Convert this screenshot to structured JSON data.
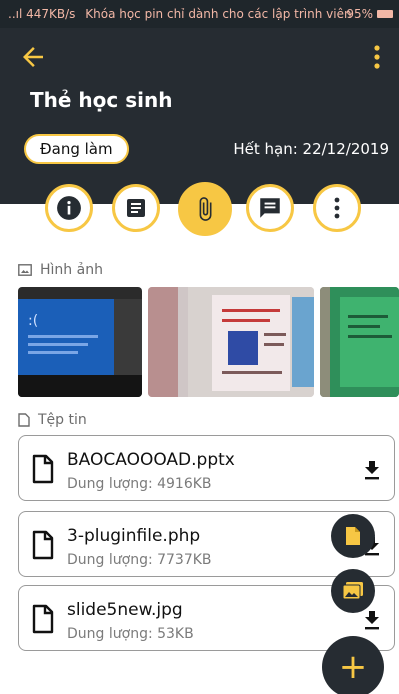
{
  "status_bar": {
    "left_text": "..ıl 447KB/s",
    "notification_text": "Khóa học pin chỉ dành cho các lập trình viên",
    "battery": "95%"
  },
  "header": {
    "title": "Thẻ học sinh",
    "status_label": "Đang làm",
    "expiry_label": "Hết hạn: 22/12/2019"
  },
  "tabs": [
    {
      "icon": "info-icon",
      "active": false
    },
    {
      "icon": "document-icon",
      "active": false
    },
    {
      "icon": "attachment-icon",
      "active": true
    },
    {
      "icon": "comment-icon",
      "active": false
    },
    {
      "icon": "more-vertical-icon",
      "active": false
    }
  ],
  "images_section": {
    "label": "Hình ảnh",
    "icon": "image-icon"
  },
  "files_section": {
    "label": "Tệp tin",
    "icon": "file-outline-icon",
    "files": [
      {
        "name": "BAOCAOOOAD.pptx",
        "size": "Dung lượng: 4916KB"
      },
      {
        "name": "3-pluginfile.php",
        "size": "Dung lượng: 7737KB"
      },
      {
        "name": "slide5new.jpg",
        "size": "Dung lượng: 53KB"
      }
    ]
  },
  "fab": {
    "main_label": "+",
    "add_file_icon": "add-file-icon",
    "add_image_icon": "add-image-icon"
  },
  "colors": {
    "accent": "#f7c744",
    "header_bg": "#262c32",
    "border": "#9a9a9a"
  }
}
